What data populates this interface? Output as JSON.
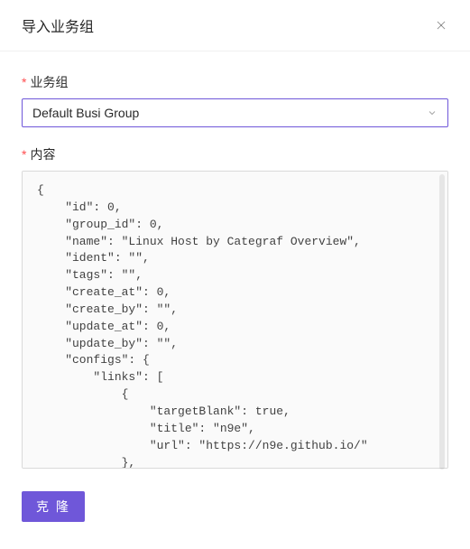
{
  "modal": {
    "title": "导入业务组"
  },
  "form": {
    "businessGroup": {
      "label": "业务组",
      "value": "Default Busi Group"
    },
    "content": {
      "label": "内容",
      "value": "{\n    \"id\": 0,\n    \"group_id\": 0,\n    \"name\": \"Linux Host by Categraf Overview\",\n    \"ident\": \"\",\n    \"tags\": \"\",\n    \"create_at\": 0,\n    \"create_by\": \"\",\n    \"update_at\": 0,\n    \"update_by\": \"\",\n    \"configs\": {\n        \"links\": [\n            {\n                \"targetBlank\": true,\n                \"title\": \"n9e\",\n                \"url\": \"https://n9e.github.io/\"\n            },"
    }
  },
  "actions": {
    "clone": "克 隆"
  }
}
